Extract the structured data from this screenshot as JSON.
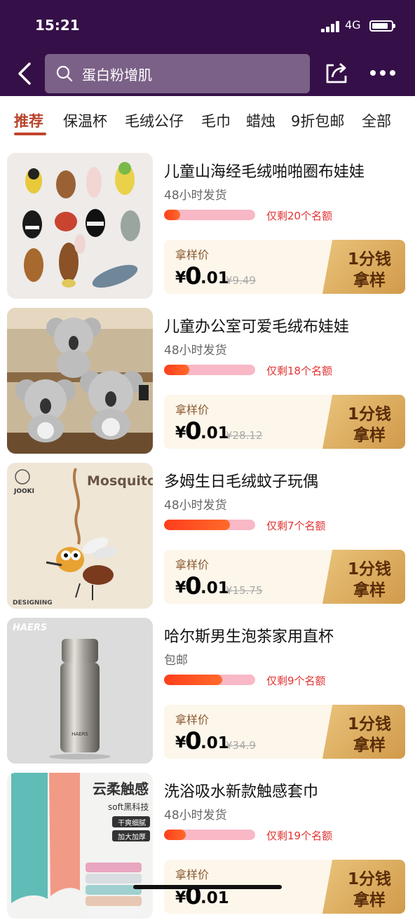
{
  "status": {
    "time": "15:21",
    "network": "4G"
  },
  "search": {
    "query": "蛋白粉增肌"
  },
  "tabs": [
    "推荐",
    "保温杯",
    "毛绒公仔",
    "毛巾",
    "蜡烛",
    "9折包邮",
    "全部"
  ],
  "active_tab": "推荐",
  "common": {
    "price_label": "拿样价",
    "currency": "¥",
    "cta_line1": "1分钱",
    "cta_line2": "拿样"
  },
  "items": [
    {
      "title": "儿童山海经毛绒啪啪圈布娃娃",
      "shipping": "48小时发货",
      "remaining": "仅剩20个名额",
      "progress": 0.18,
      "price_int": "0",
      "price_dec": ".01",
      "original_price": "¥9.49"
    },
    {
      "title": "儿童办公室可爱毛绒布娃娃",
      "shipping": "48小时发货",
      "remaining": "仅剩18个名额",
      "progress": 0.28,
      "price_int": "0",
      "price_dec": ".01",
      "original_price": "¥28.12"
    },
    {
      "title": "多姆生日毛绒蚊子玩偶",
      "shipping": "48小时发货",
      "remaining": "仅剩7个名额",
      "progress": 0.72,
      "price_int": "0",
      "price_dec": ".01",
      "original_price": "¥15.75",
      "image_text": {
        "brand": "JOOKI",
        "name": "Mosquito",
        "footer": "DESIGNING"
      }
    },
    {
      "title": "哈尔斯男生泡茶家用直杯",
      "shipping": "包邮",
      "remaining": "仅剩9个名额",
      "progress": 0.64,
      "price_int": "0",
      "price_dec": ".01",
      "original_price": "¥34.9",
      "image_text": {
        "brand": "HAERS"
      }
    },
    {
      "title": "洗浴吸水新款触感套巾",
      "shipping": "48小时发货",
      "remaining": "仅剩19个名额",
      "progress": 0.24,
      "price_int": "0",
      "price_dec": ".01",
      "original_price": "",
      "image_text": {
        "headline": "云柔触感",
        "sub": "soft黑科技",
        "tag1": "干爽细腻",
        "tag2": "加大加厚"
      }
    }
  ]
}
